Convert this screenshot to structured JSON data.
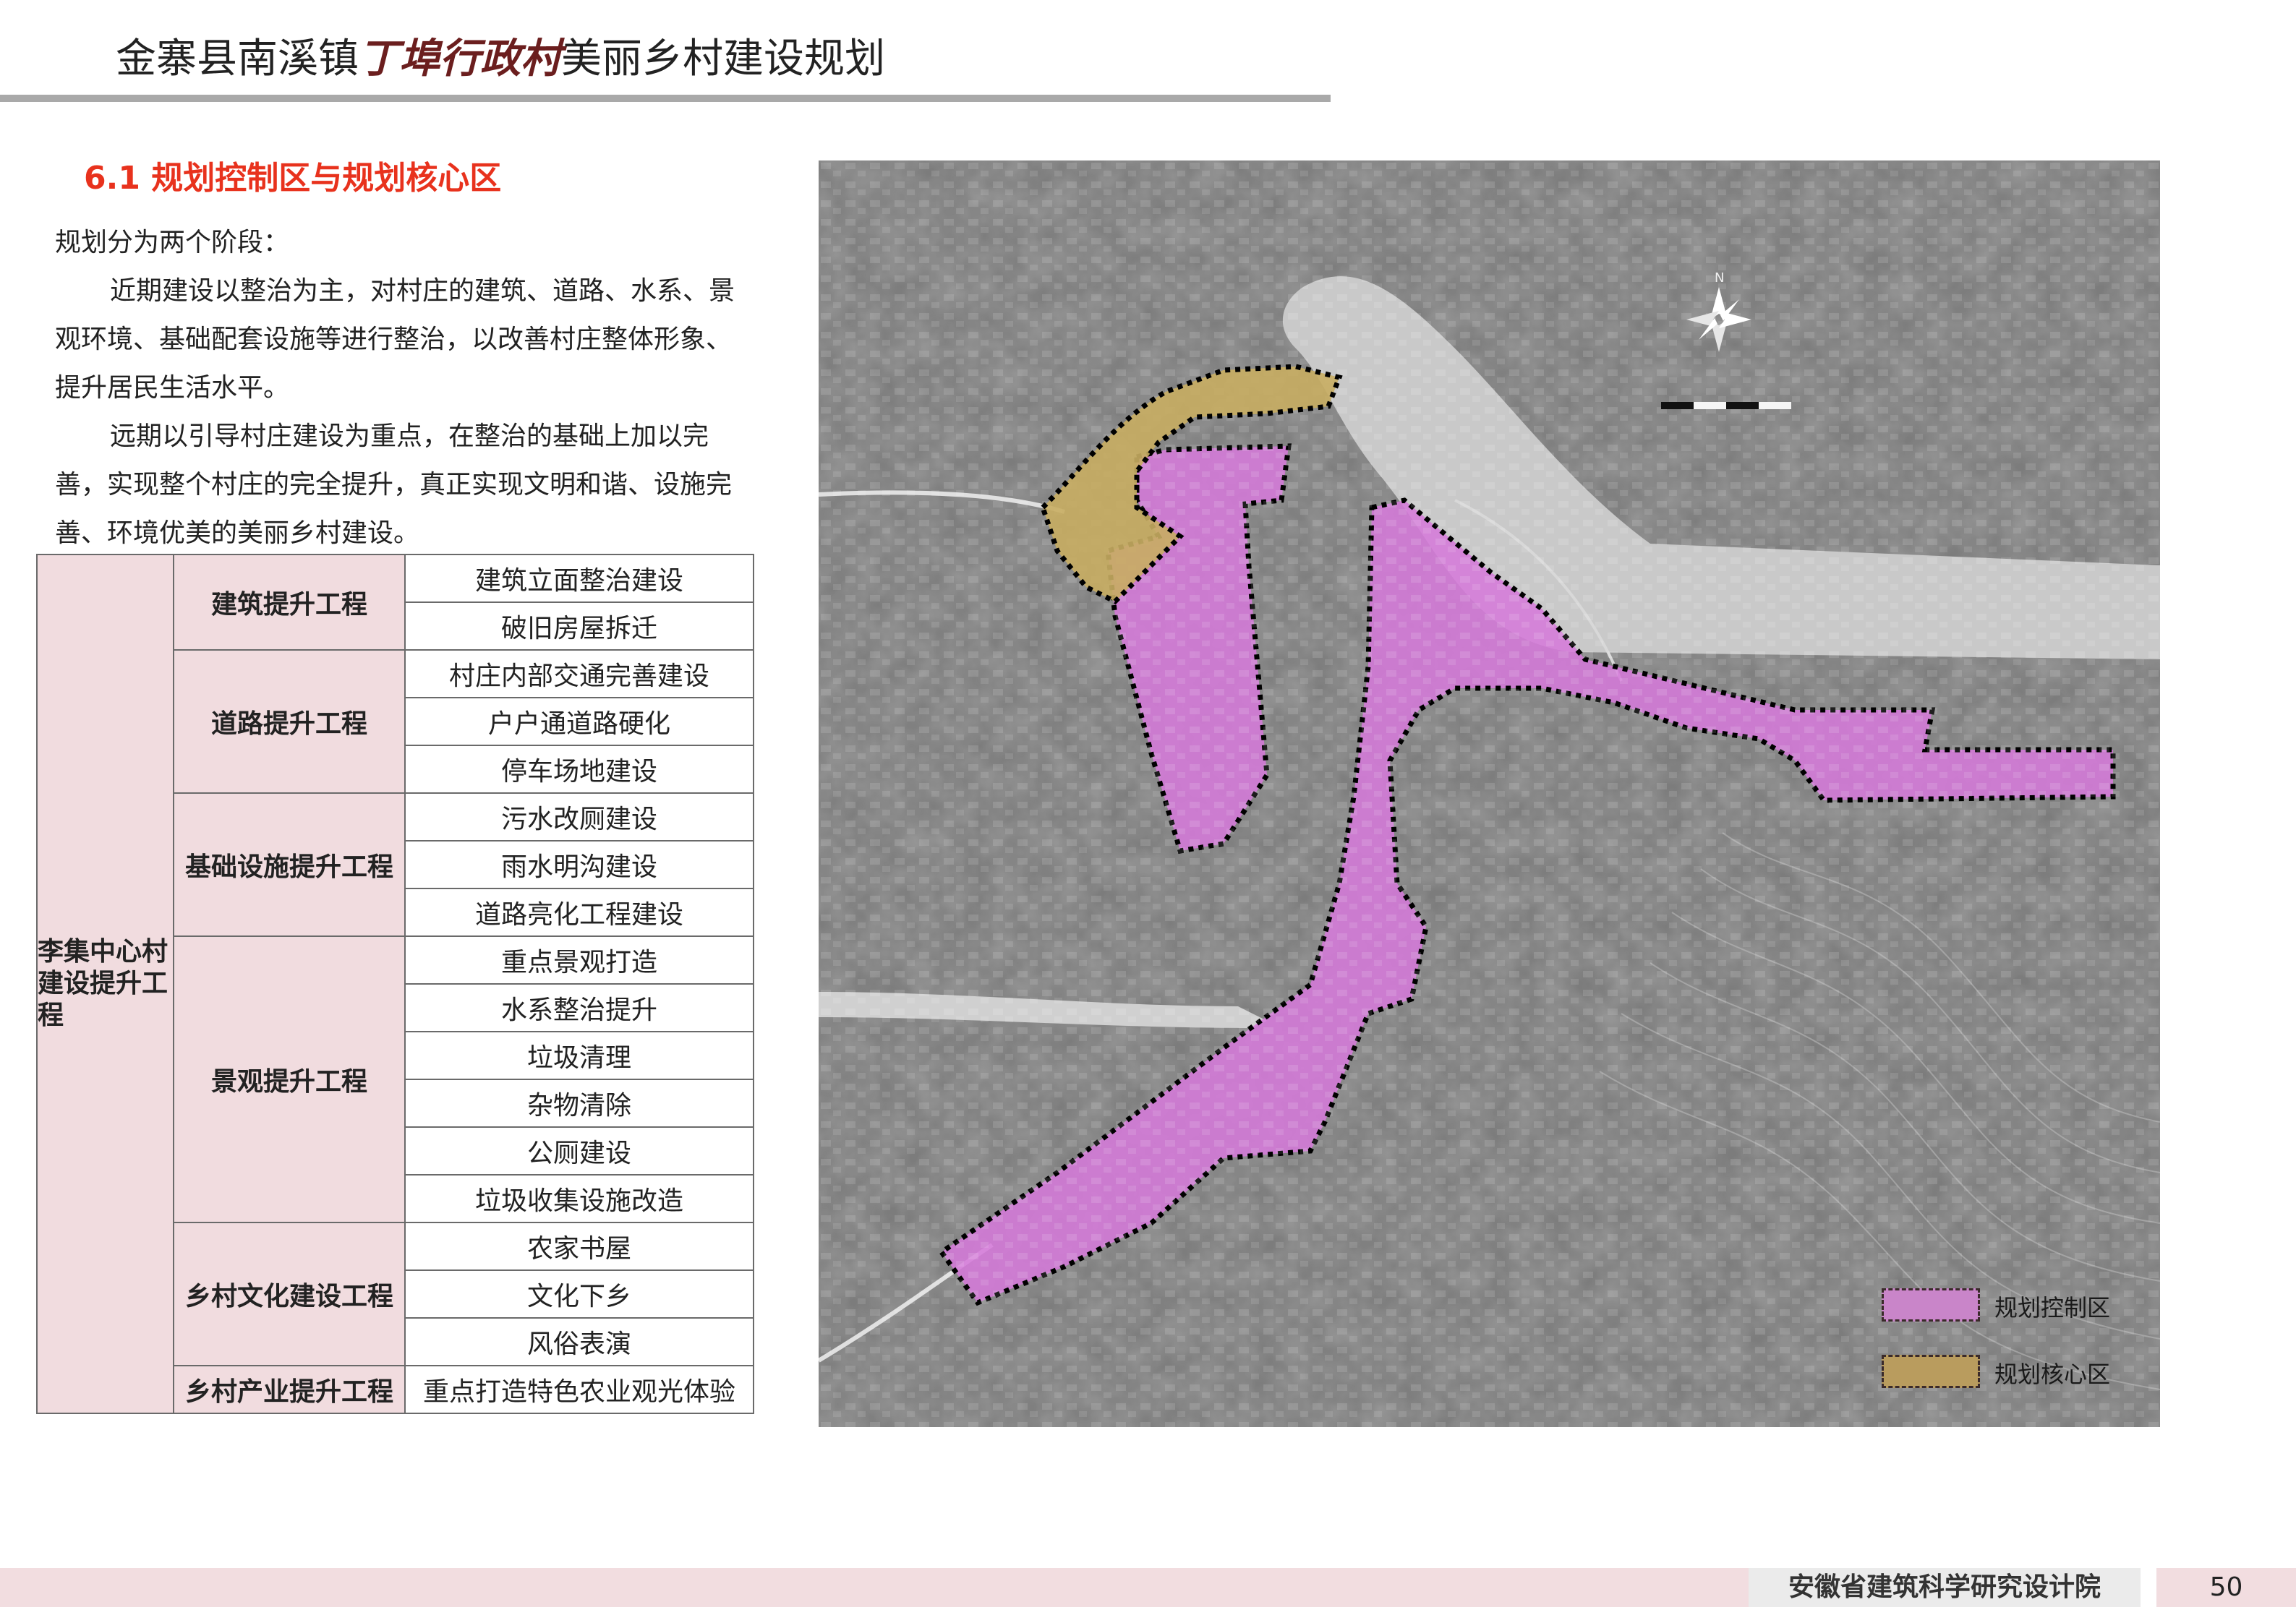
{
  "header": {
    "title_prefix": "金寨县南溪镇",
    "title_highlight": "丁埠行政村",
    "title_suffix": "美丽乡村建设规划"
  },
  "section": {
    "heading": "6.1 规划控制区与规划核心区",
    "intro": "规划分为两个阶段：",
    "para1": "近期建设以整治为主，对村庄的建筑、道路、水系、景观环境、基础配套设施等进行整治，以改善村庄整体形象、提升居民生活水平。",
    "para2": "远期以引导村庄建设为重点，在整治的基础上加以完善，实现整个村庄的完全提升，真正实现文明和谐、设施完善、环境优美的美丽乡村建设。"
  },
  "table": {
    "root": "李集中心村建设提升工程",
    "groups": [
      {
        "category": "建筑提升工程",
        "items": [
          "建筑立面整治建设",
          "破旧房屋拆迁"
        ]
      },
      {
        "category": "道路提升工程",
        "items": [
          "村庄内部交通完善建设",
          "户户通道路硬化",
          "停车场地建设"
        ]
      },
      {
        "category": "基础设施提升工程",
        "items": [
          "污水改厕建设",
          "雨水明沟建设",
          "道路亮化工程建设"
        ]
      },
      {
        "category": "景观提升工程",
        "items": [
          "重点景观打造",
          "水系整治提升",
          "垃圾清理",
          "杂物清除",
          "公厕建设",
          "垃圾收集设施改造"
        ]
      },
      {
        "category": "乡村文化建设工程",
        "items": [
          "农家书屋",
          "文化下乡",
          "风俗表演"
        ]
      },
      {
        "category": "乡村产业提升工程",
        "items": [
          "重点打造特色农业观光体验"
        ]
      }
    ]
  },
  "map": {
    "compass_label": "N",
    "legend": [
      {
        "label": "规划控制区",
        "color": "#c985c9"
      },
      {
        "label": "规划核心区",
        "color": "#b99c5e"
      }
    ],
    "control_color": "#d57ad9",
    "core_color": "#c8ad62"
  },
  "footer": {
    "org": "安徽省建筑科学研究设计院",
    "page": "50"
  }
}
